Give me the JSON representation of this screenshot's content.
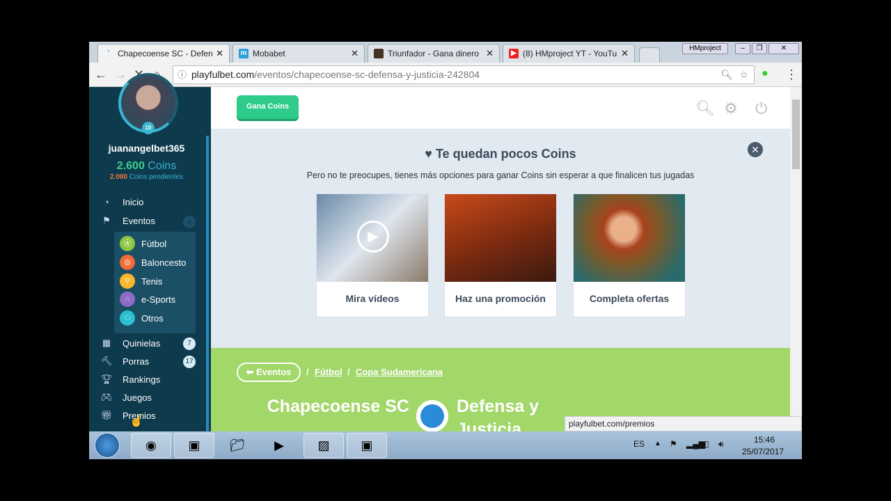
{
  "browser": {
    "tabs": [
      {
        "title": "Chapecoense SC - Defen",
        "active": true
      },
      {
        "title": "Mobabet",
        "active": false
      },
      {
        "title": "Triunfador - Gana dinero",
        "active": false
      },
      {
        "title": "(8) HMproject YT - YouTu",
        "active": false
      }
    ],
    "profile_label": "HMproject",
    "url_domain": "playfulbet.com",
    "url_path": "/eventos/chapecoense-sc-defensa-y-justicia-242804",
    "status_url": "playfulbet.com/premios"
  },
  "sidebar": {
    "level": "10",
    "username": "juanangelbet365",
    "coins_value": "2.600",
    "coins_label": "Coins",
    "pending_value": "2.000",
    "pending_label": "Coins pendientes",
    "menu": [
      {
        "label": "Inicio",
        "icon": "dashboard-icon"
      },
      {
        "label": "Eventos",
        "icon": "flag-icon"
      },
      {
        "label": "Quinielas",
        "icon": "table-icon",
        "badge": "7"
      },
      {
        "label": "Porras",
        "icon": "gavel-icon",
        "badge": "17"
      },
      {
        "label": "Rankings",
        "icon": "trophy-icon"
      },
      {
        "label": "Juegos",
        "icon": "gamepad-icon"
      },
      {
        "label": "Premios",
        "icon": "gift-icon"
      }
    ],
    "sports": [
      {
        "label": "Fútbol",
        "color": "#8cc63f"
      },
      {
        "label": "Baloncesto",
        "color": "#f26b3a"
      },
      {
        "label": "Tenis",
        "color": "#f7b92b"
      },
      {
        "label": "e-Sports",
        "color": "#8e6bc4"
      },
      {
        "label": "Otros",
        "color": "#2bbfcf"
      }
    ]
  },
  "header": {
    "gana_coins": "Gana Coins"
  },
  "promo": {
    "title": "Te quedan pocos Coins",
    "subtitle": "Pero no te preocupes, tienes más opciones para ganar Coins sin esperar a que finalicen tus jugadas",
    "cards": [
      {
        "label": "Mira vídeos"
      },
      {
        "label": "Haz una promoción"
      },
      {
        "label": "Completa ofertas"
      }
    ]
  },
  "event": {
    "back_label": "Eventos",
    "breadcrumb": [
      "Fútbol",
      "Copa Sudamericana"
    ],
    "home_team": "Chapecoense SC",
    "away_team": "Defensa y Justicia"
  },
  "taskbar": {
    "lang": "ES",
    "time": "15:46",
    "date": "25/07/2017"
  }
}
